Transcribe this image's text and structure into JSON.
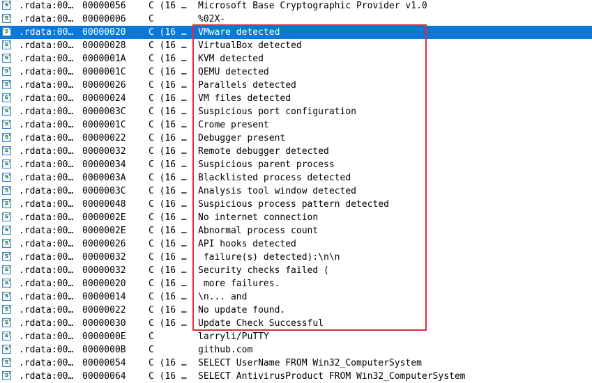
{
  "colors": {
    "selection": "#0a78d7",
    "highlight_border": "#e8283c",
    "icon_border": "#3b82c6"
  },
  "row_icon": {
    "name": "string-icon",
    "glyph": "'s'"
  },
  "selected_row_index": 2,
  "rows": [
    {
      "address": ".rdata:00…",
      "length": "00000056",
      "type": "C (16 …",
      "string": "Microsoft Base Cryptographic Provider v1.0"
    },
    {
      "address": ".rdata:00…",
      "length": "00000006",
      "type": "C",
      "string": "%02X-"
    },
    {
      "address": ".rdata:00…",
      "length": "00000020",
      "type": "C (16 …",
      "string": "VMware detected"
    },
    {
      "address": ".rdata:00…",
      "length": "00000028",
      "type": "C (16 …",
      "string": "VirtualBox detected"
    },
    {
      "address": ".rdata:00…",
      "length": "0000001A",
      "type": "C (16 …",
      "string": "KVM detected"
    },
    {
      "address": ".rdata:00…",
      "length": "0000001C",
      "type": "C (16 …",
      "string": "QEMU detected"
    },
    {
      "address": ".rdata:00…",
      "length": "00000026",
      "type": "C (16 …",
      "string": "Parallels detected"
    },
    {
      "address": ".rdata:00…",
      "length": "00000024",
      "type": "C (16 …",
      "string": "VM files detected"
    },
    {
      "address": ".rdata:00…",
      "length": "0000003C",
      "type": "C (16 …",
      "string": "Suspicious port configuration"
    },
    {
      "address": ".rdata:00…",
      "length": "0000001C",
      "type": "C (16 …",
      "string": "Crome present"
    },
    {
      "address": ".rdata:00…",
      "length": "00000022",
      "type": "C (16 …",
      "string": "Debugger present"
    },
    {
      "address": ".rdata:00…",
      "length": "00000032",
      "type": "C (16 …",
      "string": "Remote debugger detected"
    },
    {
      "address": ".rdata:00…",
      "length": "00000034",
      "type": "C (16 …",
      "string": "Suspicious parent process"
    },
    {
      "address": ".rdata:00…",
      "length": "0000003A",
      "type": "C (16 …",
      "string": "Blacklisted process detected"
    },
    {
      "address": ".rdata:00…",
      "length": "0000003C",
      "type": "C (16 …",
      "string": "Analysis tool window detected"
    },
    {
      "address": ".rdata:00…",
      "length": "00000048",
      "type": "C (16 …",
      "string": "Suspicious process pattern detected"
    },
    {
      "address": ".rdata:00…",
      "length": "0000002E",
      "type": "C (16 …",
      "string": "No internet connection"
    },
    {
      "address": ".rdata:00…",
      "length": "0000002E",
      "type": "C (16 …",
      "string": "Abnormal process count"
    },
    {
      "address": ".rdata:00…",
      "length": "00000026",
      "type": "C (16 …",
      "string": "API hooks detected"
    },
    {
      "address": ".rdata:00…",
      "length": "00000032",
      "type": "C (16 …",
      "string": " failure(s) detected):\\n\\n"
    },
    {
      "address": ".rdata:00…",
      "length": "00000032",
      "type": "C (16 …",
      "string": "Security checks failed ("
    },
    {
      "address": ".rdata:00…",
      "length": "00000020",
      "type": "C (16 …",
      "string": " more failures."
    },
    {
      "address": ".rdata:00…",
      "length": "00000014",
      "type": "C (16 …",
      "string": "\\n... and"
    },
    {
      "address": ".rdata:00…",
      "length": "00000022",
      "type": "C (16 …",
      "string": "No update found."
    },
    {
      "address": ".rdata:00…",
      "length": "00000030",
      "type": "C (16 …",
      "string": "Update Check Successful"
    },
    {
      "address": ".rdata:00…",
      "length": "0000000E",
      "type": "C",
      "string": "larryli/PuTTY"
    },
    {
      "address": ".rdata:00…",
      "length": "0000000B",
      "type": "C",
      "string": "github.com"
    },
    {
      "address": ".rdata:00…",
      "length": "00000054",
      "type": "C (16 …",
      "string": "SELECT UserName FROM Win32_ComputerSystem"
    },
    {
      "address": ".rdata:00…",
      "length": "00000064",
      "type": "C (16 …",
      "string": "SELECT AntivirusProduct FROM Win32_ComputerSystem"
    }
  ]
}
